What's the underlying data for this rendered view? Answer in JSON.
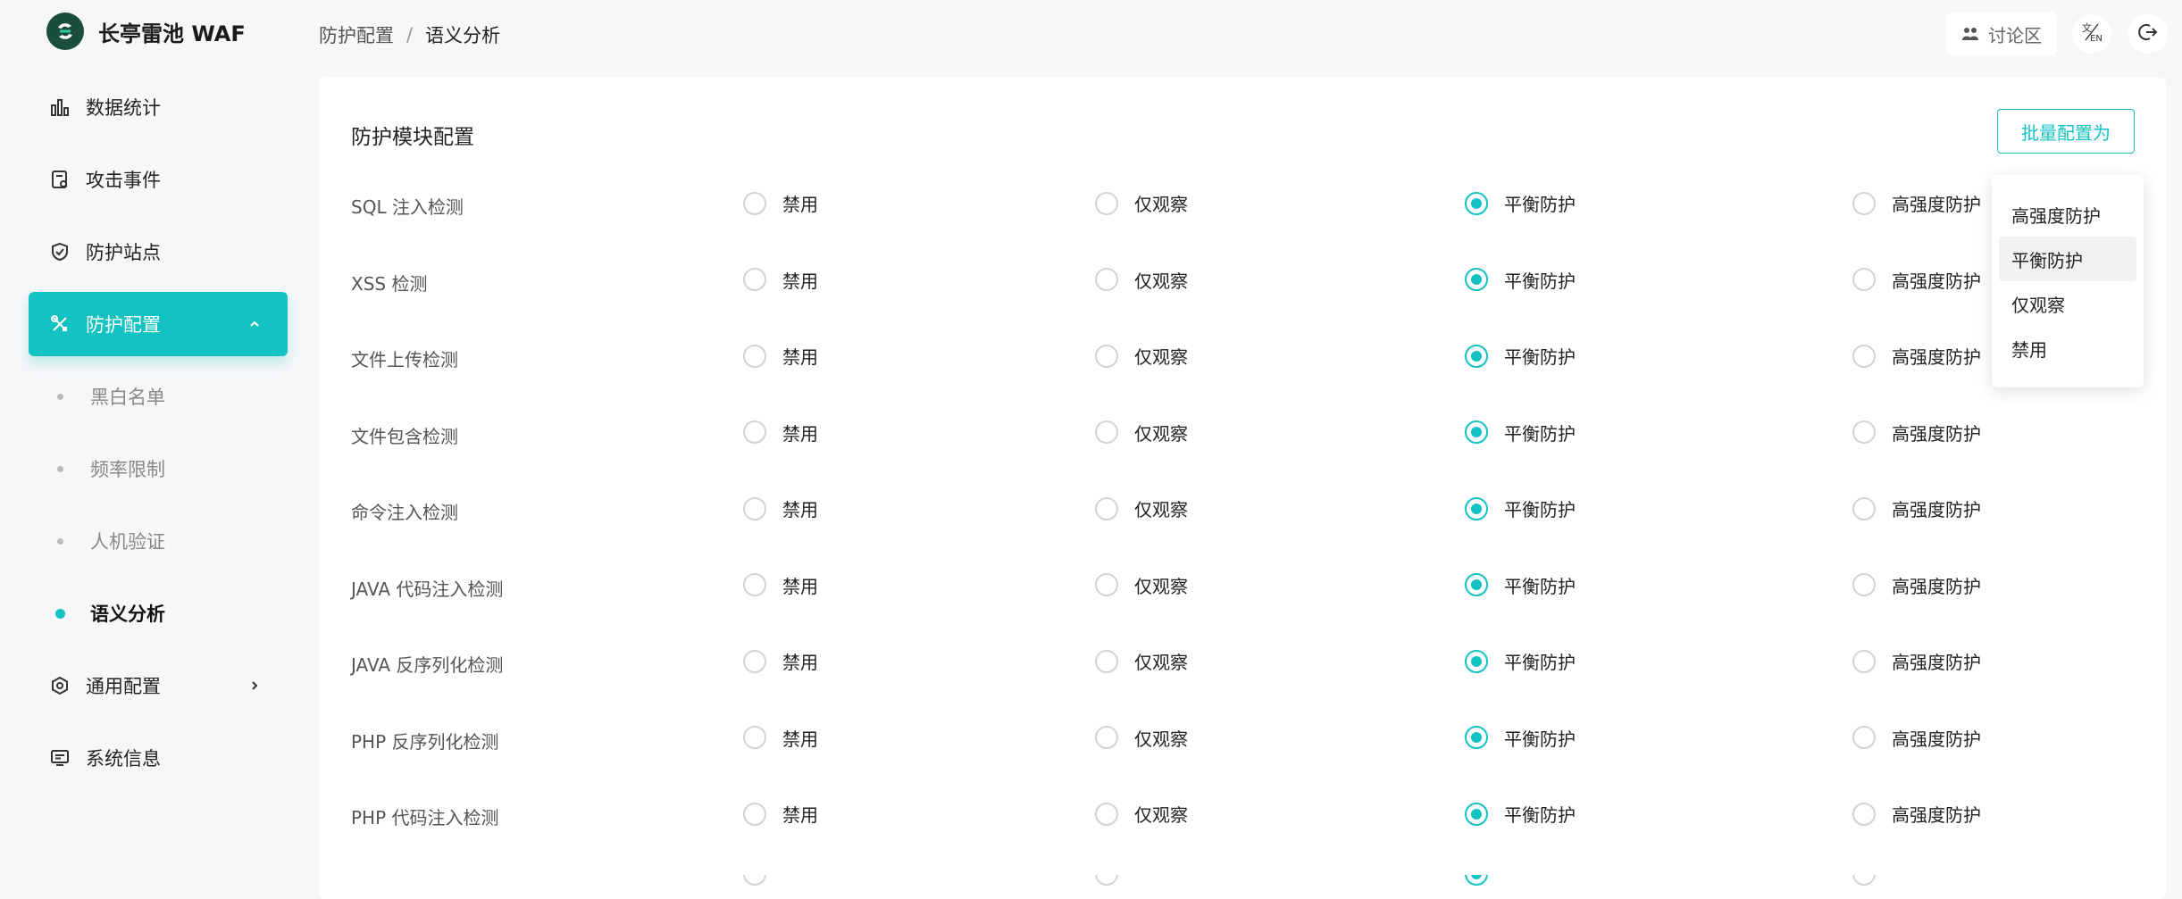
{
  "app": {
    "name": "长亭雷池 WAF"
  },
  "breadcrumb": {
    "parent": "防护配置",
    "separator": "/",
    "current": "语义分析"
  },
  "header": {
    "forum_label": "讨论区",
    "lang_icon": "language-icon",
    "logout_icon": "logout-icon"
  },
  "sidebar": {
    "items": [
      {
        "label": "数据统计",
        "icon": "bar-chart-icon"
      },
      {
        "label": "攻击事件",
        "icon": "event-icon"
      },
      {
        "label": "防护站点",
        "icon": "shield-icon"
      },
      {
        "label": "防护配置",
        "icon": "tools-icon",
        "active": true,
        "expanded": true
      },
      {
        "label": "通用配置",
        "icon": "settings-icon"
      },
      {
        "label": "系统信息",
        "icon": "monitor-icon"
      }
    ],
    "sub_items": [
      {
        "label": "黑白名单"
      },
      {
        "label": "频率限制"
      },
      {
        "label": "人机验证"
      },
      {
        "label": "语义分析",
        "active": true
      }
    ]
  },
  "main": {
    "title": "防护模块配置",
    "batch_button": "批量配置为",
    "options": [
      "禁用",
      "仅观察",
      "平衡防护",
      "高强度防护"
    ],
    "modules": [
      {
        "name": "SQL 注入检测",
        "selected": "平衡防护"
      },
      {
        "name": "XSS 检测",
        "selected": "平衡防护"
      },
      {
        "name": "文件上传检测",
        "selected": "平衡防护"
      },
      {
        "name": "文件包含检测",
        "selected": "平衡防护"
      },
      {
        "name": "命令注入检测",
        "selected": "平衡防护"
      },
      {
        "name": "JAVA 代码注入检测",
        "selected": "平衡防护"
      },
      {
        "name": "JAVA 反序列化检测",
        "selected": "平衡防护"
      },
      {
        "name": "PHP 反序列化检测",
        "selected": "平衡防护"
      },
      {
        "name": "PHP 代码注入检测",
        "selected": "平衡防护"
      }
    ]
  },
  "dropdown": {
    "items": [
      "高强度防护",
      "平衡防护",
      "仅观察",
      "禁用"
    ],
    "hovered": "平衡防护"
  },
  "colors": {
    "accent": "#13c2c2",
    "background": "#f6f7f9",
    "brand_logo": "#1b4d3e"
  }
}
